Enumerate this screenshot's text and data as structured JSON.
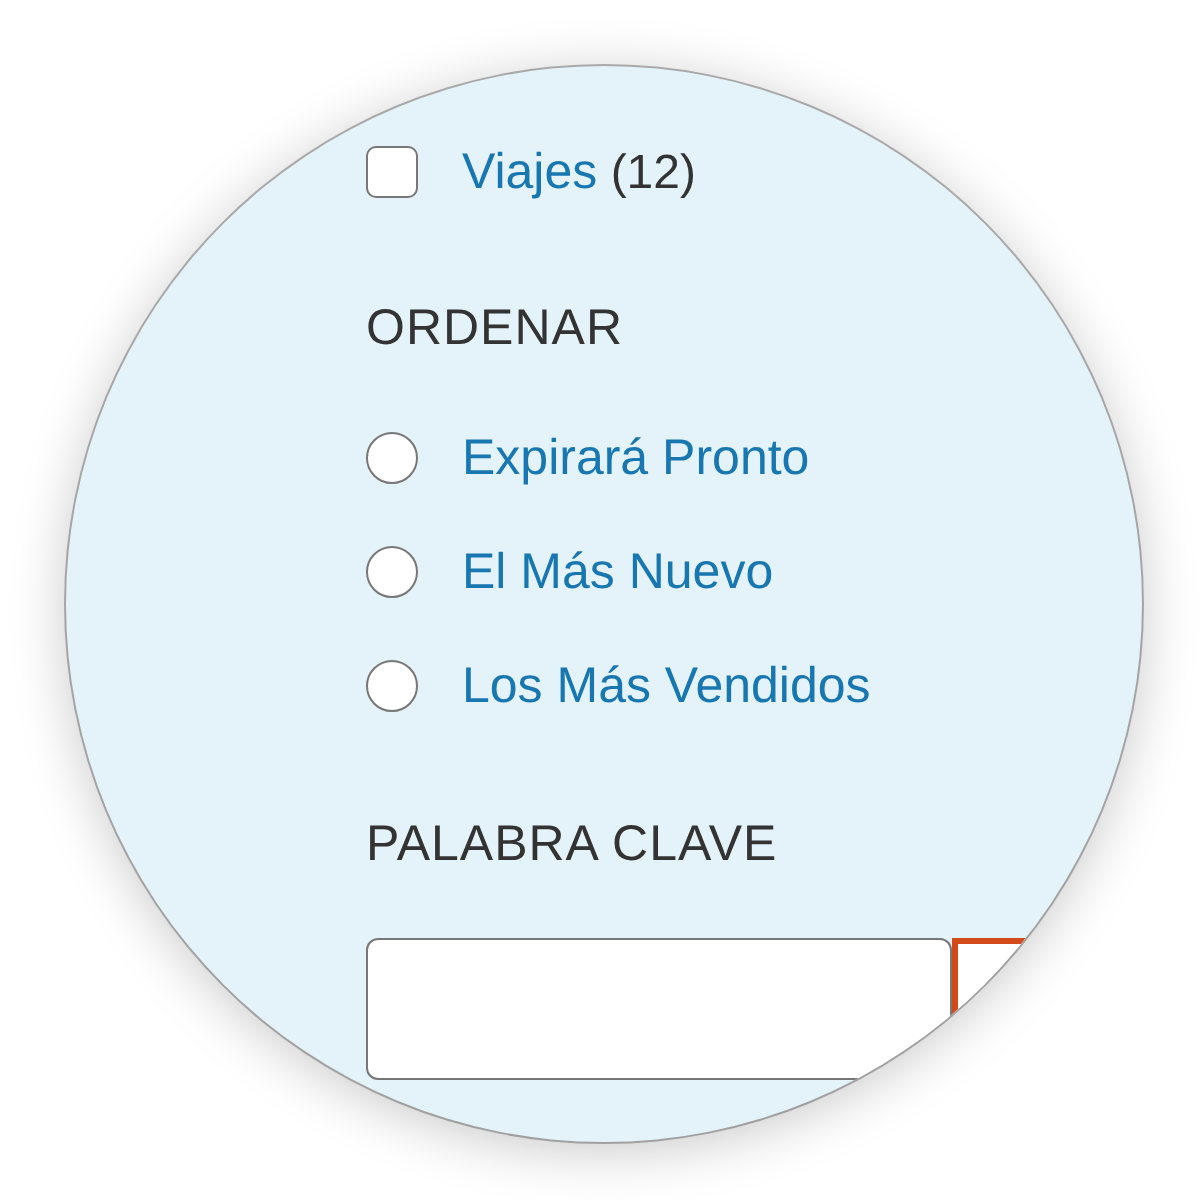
{
  "categories": [
    {
      "label": "Viajes",
      "count": "(12)",
      "checked": false
    }
  ],
  "sort": {
    "heading": "ORDENAR",
    "options": [
      {
        "label": "Expirará Pronto",
        "selected": false
      },
      {
        "label": "El Más Nuevo",
        "selected": false
      },
      {
        "label": "Los Más Vendidos",
        "selected": false
      }
    ]
  },
  "keyword": {
    "heading": "PALABRA CLAVE"
  }
}
